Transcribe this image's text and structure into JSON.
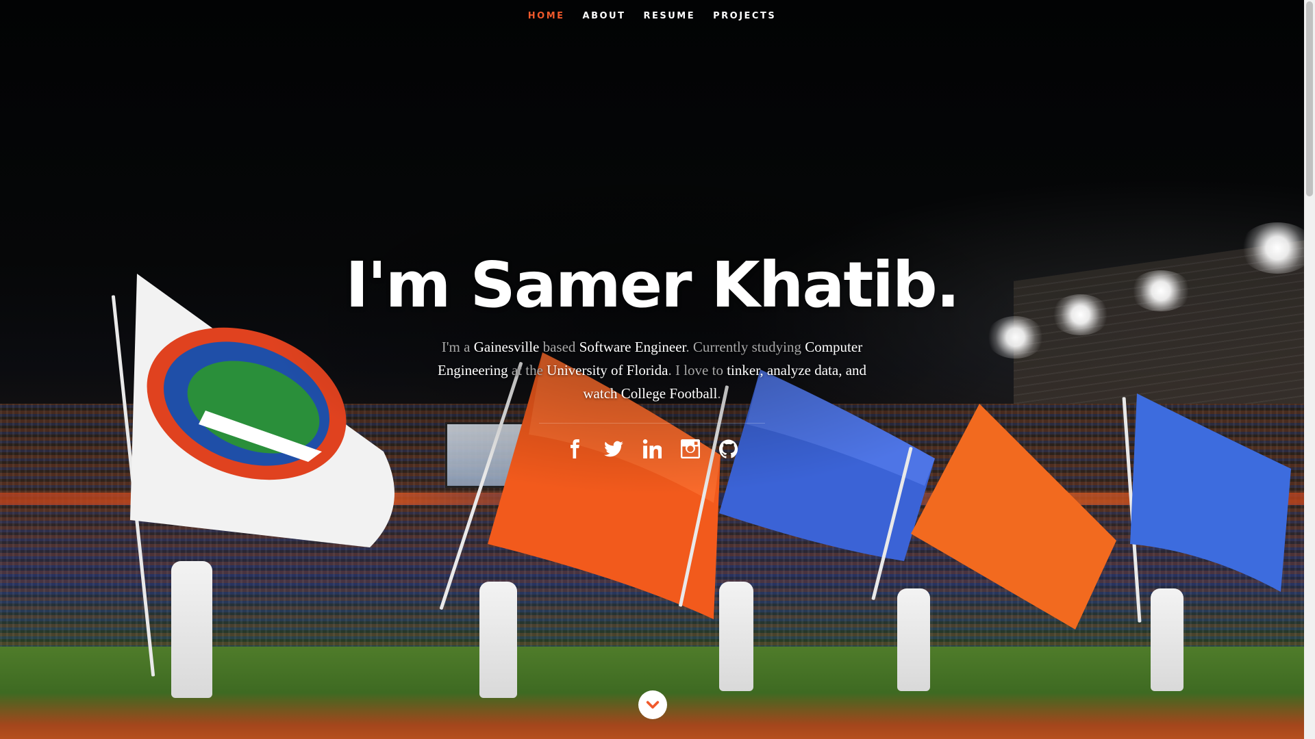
{
  "nav": {
    "items": [
      {
        "label": "HOME",
        "active": true
      },
      {
        "label": "ABOUT",
        "active": false
      },
      {
        "label": "RESUME",
        "active": false
      },
      {
        "label": "PROJECTS",
        "active": false
      }
    ]
  },
  "banner": {
    "headline": "I'm Samer Khatib.",
    "intro": [
      {
        "text": "I'm a ",
        "highlight": false
      },
      {
        "text": "Gainesville",
        "highlight": true
      },
      {
        "text": " based ",
        "highlight": false
      },
      {
        "text": "Software Engineer",
        "highlight": true
      },
      {
        "text": ". Currently studying ",
        "highlight": false
      },
      {
        "text": "Computer Engineering",
        "highlight": true
      },
      {
        "text": " at the ",
        "highlight": false
      },
      {
        "text": "University of Florida",
        "highlight": true
      },
      {
        "text": ". I love to ",
        "highlight": false
      },
      {
        "text": "tinker, analyze data,",
        "highlight": true
      },
      {
        "text": " ",
        "highlight": false
      },
      {
        "text": "and watch College Football",
        "highlight": true
      },
      {
        "text": ".",
        "highlight": false
      }
    ]
  },
  "social": [
    {
      "icon": "facebook-icon"
    },
    {
      "icon": "twitter-icon"
    },
    {
      "icon": "linkedin-icon"
    },
    {
      "icon": "instagram-icon"
    },
    {
      "icon": "github-icon"
    }
  ],
  "scroll_down": {
    "icon": "chevron-down-icon"
  },
  "colors": {
    "accent": "#f0592b",
    "text": "#ffffff",
    "muted_text": "#a8a8a8",
    "background": "#000000"
  }
}
